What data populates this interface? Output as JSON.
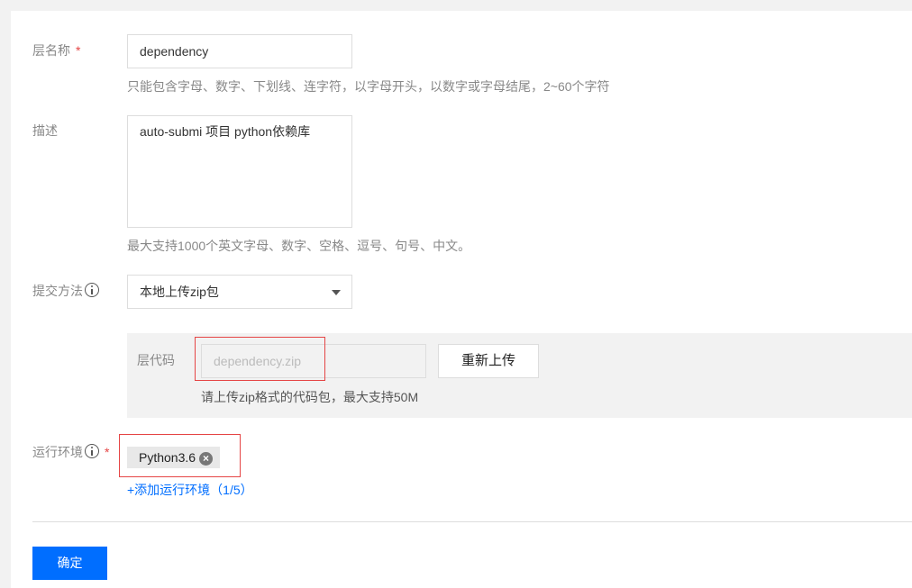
{
  "form": {
    "layer_name": {
      "label": "层名称",
      "required_mark": "*",
      "value": "dependency",
      "hint": "只能包含字母、数字、下划线、连字符，以字母开头，以数字或字母结尾，2~60个字符"
    },
    "description": {
      "label": "描述",
      "value": "auto-submi 项目 python依赖库",
      "hint": "最大支持1000个英文字母、数字、空格、逗号、句号、中文。"
    },
    "submit_method": {
      "label": "提交方法",
      "icon": "info-icon",
      "selected": "本地上传zip包"
    },
    "layer_code": {
      "label": "层代码",
      "file_placeholder": "dependency.zip",
      "reupload_label": "重新上传",
      "hint": "请上传zip格式的代码包，最大支持50M"
    },
    "runtime": {
      "label": "运行环境",
      "icon": "info-icon",
      "required_mark": "*",
      "tags": [
        "Python3.6"
      ],
      "add_link": "+添加运行环境（1/5）"
    },
    "confirm_label": "确定"
  },
  "colors": {
    "primary": "#006eff",
    "required": "#e54545",
    "highlight_box": "#e54545"
  }
}
